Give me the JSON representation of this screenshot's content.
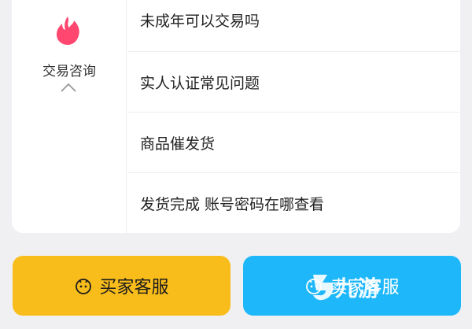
{
  "category": {
    "label": "交易咨询",
    "icon": "flame-icon",
    "accent": "#ff4770"
  },
  "faq": [
    {
      "label": "未成年可以交易吗"
    },
    {
      "label": "实人认证常见问题"
    },
    {
      "label": "商品催发货"
    },
    {
      "label": "发货完成 账号密码在哪查看"
    }
  ],
  "buttons": {
    "buyer": {
      "label": "买家客服",
      "icon": "face-icon",
      "color": "#f9bd1b"
    },
    "seller": {
      "label": "卖家客服",
      "icon": "face-icon",
      "color": "#1db7fa"
    }
  },
  "watermark": {
    "text": "九游"
  }
}
